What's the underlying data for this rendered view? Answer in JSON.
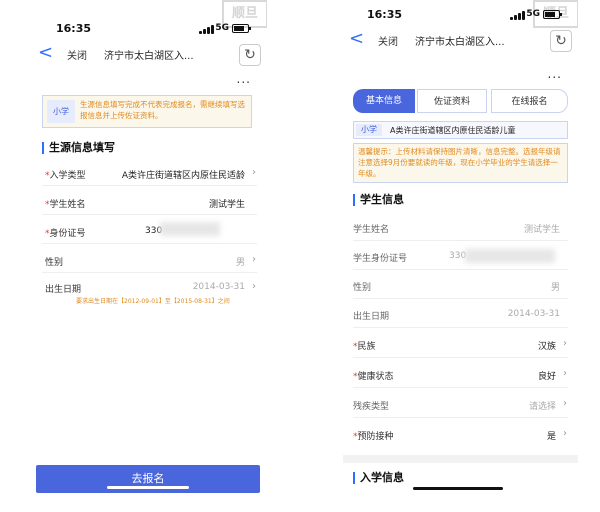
{
  "status": {
    "time": "16:35",
    "network": "5G"
  },
  "nav": {
    "back": "<",
    "close": "关闭",
    "title": "济宁市太白湖区入...",
    "refresh": "↻",
    "more": "..."
  },
  "stamp": {
    "text": "顺旦"
  },
  "left": {
    "notice_tag": "小学",
    "notice_text": "生源信息填写完成不代表完成报名，需继续填写选报信息并上传佐证资料。",
    "section_title": "生源信息填写",
    "rows": [
      {
        "label": "入学类型",
        "value": "A类许庄街道辖区内原住民适龄",
        "required": true
      },
      {
        "label": "学生姓名",
        "value": "测试学生",
        "required": true
      },
      {
        "label": "身份证号",
        "value": "330",
        "required": true
      },
      {
        "label": "性别",
        "value": "男",
        "required": false
      },
      {
        "label": "出生日期",
        "value": "2014-03-31",
        "required": false
      }
    ],
    "hint": "要求出生日期在【2012-09-01】至【2015-08-31】之间",
    "submit": "去报名"
  },
  "right": {
    "steps": [
      "基本信息",
      "佐证资料",
      "在线报名"
    ],
    "category_tag": "小学",
    "category_text": "A类许庄街道辖区内原住民适龄儿童",
    "tip": "温馨提示：上传材料请保持图片清晰，信息完整。选报年级请注意选择9月份要就读的年级，现在小学毕业的学生请选择一年级。",
    "section_title": "学生信息",
    "rows": [
      {
        "label": "学生姓名",
        "value": "测试学生",
        "required": false
      },
      {
        "label": "学生身份证号",
        "value": "330",
        "required": false
      },
      {
        "label": "性别",
        "value": "男",
        "required": false
      },
      {
        "label": "出生日期",
        "value": "2014-03-31",
        "required": false
      },
      {
        "label": "民族",
        "value": "汉族",
        "required": true
      },
      {
        "label": "健康状态",
        "value": "良好",
        "required": true
      },
      {
        "label": "残疾类型",
        "value": "请选择",
        "required": false
      },
      {
        "label": "预防接种",
        "value": "是",
        "required": true
      }
    ],
    "section2_title": "入学信息"
  }
}
